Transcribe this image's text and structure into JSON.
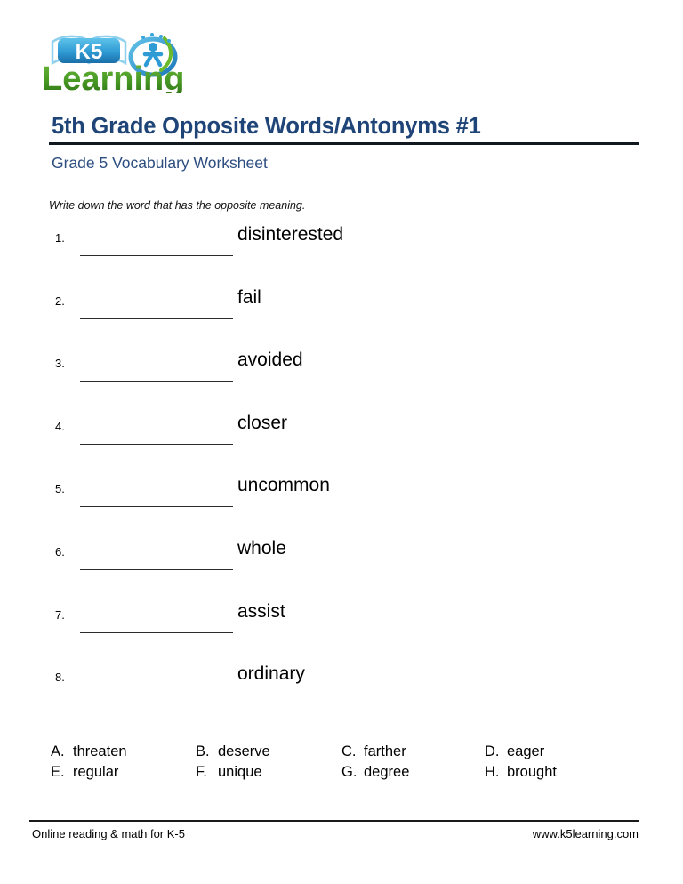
{
  "logo": {
    "name": "k5-learning-logo",
    "badge_text": "K5",
    "wordmark": "Learning",
    "colors": {
      "badge_blue": "#2f9bd4",
      "badge_blue_dark": "#1b6ea8",
      "wordmark_green": "#4a9c27",
      "wordmark_green_dark": "#2f7a14",
      "swoosh_blue": "#3aa5dc",
      "swoosh_green": "#6cb92c"
    }
  },
  "header": {
    "title": "5th Grade Opposite Words/Antonyms #1",
    "subtitle": "Grade 5 Vocabulary Worksheet",
    "instructions": "Write down the word that has the opposite meaning.",
    "title_color": "#1f4477",
    "subtitle_color": "#2c4d80"
  },
  "questions": [
    {
      "number": "1.",
      "word": "disinterested",
      "answer": ""
    },
    {
      "number": "2.",
      "word": "fail",
      "answer": ""
    },
    {
      "number": "3.",
      "word": "avoided",
      "answer": ""
    },
    {
      "number": "4.",
      "word": "closer",
      "answer": ""
    },
    {
      "number": "5.",
      "word": "uncommon",
      "answer": ""
    },
    {
      "number": "6.",
      "word": "whole",
      "answer": ""
    },
    {
      "number": "7.",
      "word": "assist",
      "answer": ""
    },
    {
      "number": "8.",
      "word": "ordinary",
      "answer": ""
    }
  ],
  "answer_bank": {
    "row1": [
      {
        "letter": "A.",
        "word": "threaten"
      },
      {
        "letter": "B.",
        "word": "deserve"
      },
      {
        "letter": "C.",
        "word": "farther"
      },
      {
        "letter": "D.",
        "word": "eager"
      }
    ],
    "row2": [
      {
        "letter": "E.",
        "word": "regular"
      },
      {
        "letter": "F.",
        "word": "unique"
      },
      {
        "letter": "G.",
        "word": "degree"
      },
      {
        "letter": "H.",
        "word": "brought"
      }
    ]
  },
  "footer": {
    "left": "Online reading & math for K-5",
    "right": "www.k5learning.com"
  }
}
